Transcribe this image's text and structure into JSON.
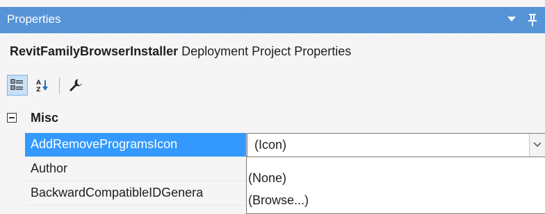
{
  "panel": {
    "title": "Properties"
  },
  "header": {
    "object_name": "RevitFamilyBrowserInstaller",
    "object_type": "Deployment Project Properties"
  },
  "toolbar": {
    "buttons": [
      "categorized-icon",
      "alphabetical-icon",
      "property-pages-icon"
    ]
  },
  "category": {
    "label": "Misc"
  },
  "properties": [
    {
      "name": "AddRemoveProgramsIcon",
      "value": "(Icon)"
    },
    {
      "name": "Author",
      "value": ""
    },
    {
      "name": "BackwardCompatibleIDGenera",
      "value": ""
    }
  ],
  "dropdown": {
    "options": [
      "(None)",
      "(Browse...)"
    ]
  }
}
